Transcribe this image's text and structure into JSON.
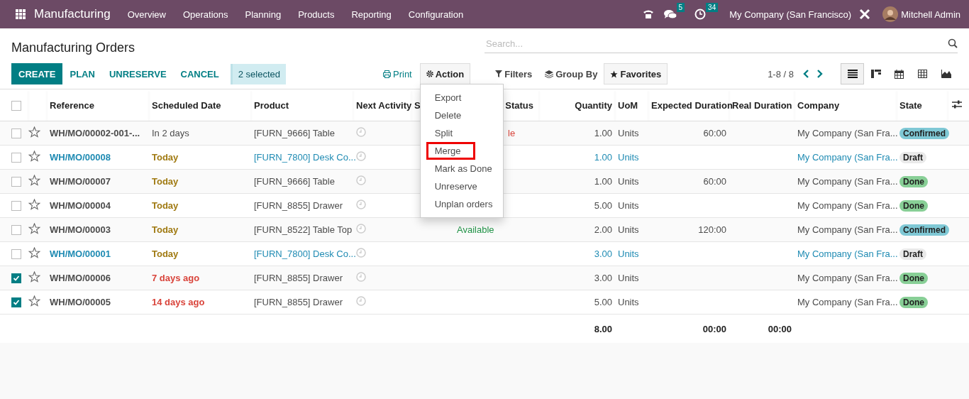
{
  "navbar": {
    "app": "Manufacturing",
    "menu": [
      "Overview",
      "Operations",
      "Planning",
      "Products",
      "Reporting",
      "Configuration"
    ],
    "messages_count": "5",
    "activities_count": "34",
    "company": "My Company (San Francisco)",
    "user": "Mitchell Admin"
  },
  "title": "Manufacturing Orders",
  "search": {
    "placeholder": "Search..."
  },
  "buttons": [
    {
      "label": "CREATE",
      "kind": "primary"
    },
    {
      "label": "PLAN",
      "kind": "link"
    },
    {
      "label": "UNRESERVE",
      "kind": "link"
    },
    {
      "label": "CANCEL",
      "kind": "link"
    }
  ],
  "selection": "2 selected",
  "print": "Print",
  "action": {
    "label": "Action",
    "expanded": true,
    "items": [
      {
        "label": "Export",
        "selected": false
      },
      {
        "label": "Delete",
        "selected": false
      },
      {
        "label": "Split",
        "selected": false
      },
      {
        "label": "Merge",
        "selected": true
      },
      {
        "label": "Mark as Done",
        "selected": false
      },
      {
        "label": "Unreserve",
        "selected": false
      },
      {
        "label": "Unplan orders",
        "selected": false
      }
    ]
  },
  "filters": "Filters",
  "group_by": "Group By",
  "favorites": "Favorites",
  "pager": "1-8 / 8",
  "views": [
    {
      "kind": "list",
      "selected": true
    },
    {
      "kind": "kanban",
      "selected": false
    },
    {
      "kind": "calendar",
      "selected": false
    },
    {
      "kind": "pivot",
      "selected": false
    },
    {
      "kind": "graph",
      "selected": false
    }
  ],
  "table": {
    "select_all": false,
    "columns": [
      "Reference",
      "Scheduled Date",
      "Product",
      "Next Activity",
      "S",
      "Status",
      "Quantity",
      "UoM",
      "Expected Duration",
      "Real Duration",
      "Company",
      "State"
    ],
    "rows": [
      {
        "checked": false,
        "kind": "normal",
        "reference": "WH/MO/00002-001-...",
        "date": {
          "text": "In 2 days"
        },
        "product": "[FURN_9666] Table",
        "status": {
          "text": "le",
          "color": "#d9443b",
          "cut_by_menu": true
        },
        "quantity": "1.00",
        "uom": "Units",
        "expected": "60:00",
        "company": "My Company (San Fra...",
        "state": {
          "label": "Confirmed",
          "color": "#7fc8d5"
        }
      },
      {
        "checked": false,
        "kind": "draft",
        "reference": "WH/MO/00008",
        "date": {
          "text": "Today",
          "color": "#a07a12"
        },
        "product": "[FURN_7800] Desk Co...",
        "quantity": "1.00",
        "uom": "Units",
        "company": "My Company (San Fra...",
        "state": {
          "label": "Draft",
          "color": "#e9e9e9"
        }
      },
      {
        "checked": false,
        "kind": "normal",
        "reference": "WH/MO/00007",
        "date": {
          "text": "Today",
          "color": "#a07a12"
        },
        "product": "[FURN_9666] Table",
        "quantity": "1.00",
        "uom": "Units",
        "expected": "60:00",
        "company": "My Company (San Fra...",
        "state": {
          "label": "Done",
          "color": "#88cf96"
        }
      },
      {
        "checked": false,
        "kind": "normal",
        "reference": "WH/MO/00004",
        "date": {
          "text": "Today",
          "color": "#a07a12"
        },
        "product": "[FURN_8855] Drawer",
        "quantity": "5.00",
        "uom": "Units",
        "company": "My Company (San Fra...",
        "state": {
          "label": "Done",
          "color": "#88cf96"
        }
      },
      {
        "checked": false,
        "kind": "normal",
        "reference": "WH/MO/00003",
        "date": {
          "text": "Today",
          "color": "#a07a12"
        },
        "product": "[FURN_8522] Table Top",
        "status": {
          "text": "Available",
          "color": "#219347",
          "cut_by_menu": false
        },
        "quantity": "2.00",
        "uom": "Units",
        "expected": "120:00",
        "company": "My Company (San Fra...",
        "state": {
          "label": "Confirmed",
          "color": "#7fc8d5"
        }
      },
      {
        "checked": false,
        "kind": "draft",
        "reference": "WH/MO/00001",
        "date": {
          "text": "Today",
          "color": "#a07a12"
        },
        "product": "[FURN_7800] Desk Co...",
        "quantity": "3.00",
        "uom": "Units",
        "company": "My Company (San Fra...",
        "state": {
          "label": "Draft",
          "color": "#e9e9e9"
        }
      },
      {
        "checked": true,
        "kind": "normal",
        "reference": "WH/MO/00006",
        "date": {
          "text": "7 days ago",
          "color": "#d9443b"
        },
        "product": "[FURN_8855] Drawer",
        "quantity": "3.00",
        "uom": "Units",
        "company": "My Company (San Fra...",
        "state": {
          "label": "Done",
          "color": "#88cf96"
        }
      },
      {
        "checked": true,
        "kind": "normal",
        "reference": "WH/MO/00005",
        "date": {
          "text": "14 days ago",
          "color": "#d9443b"
        },
        "product": "[FURN_8855] Drawer",
        "quantity": "5.00",
        "uom": "Units",
        "company": "My Company (San Fra...",
        "state": {
          "label": "Done",
          "color": "#88cf96"
        }
      }
    ],
    "totals": {
      "quantity": "8.00",
      "expected": "00:00",
      "real": "00:00"
    }
  }
}
